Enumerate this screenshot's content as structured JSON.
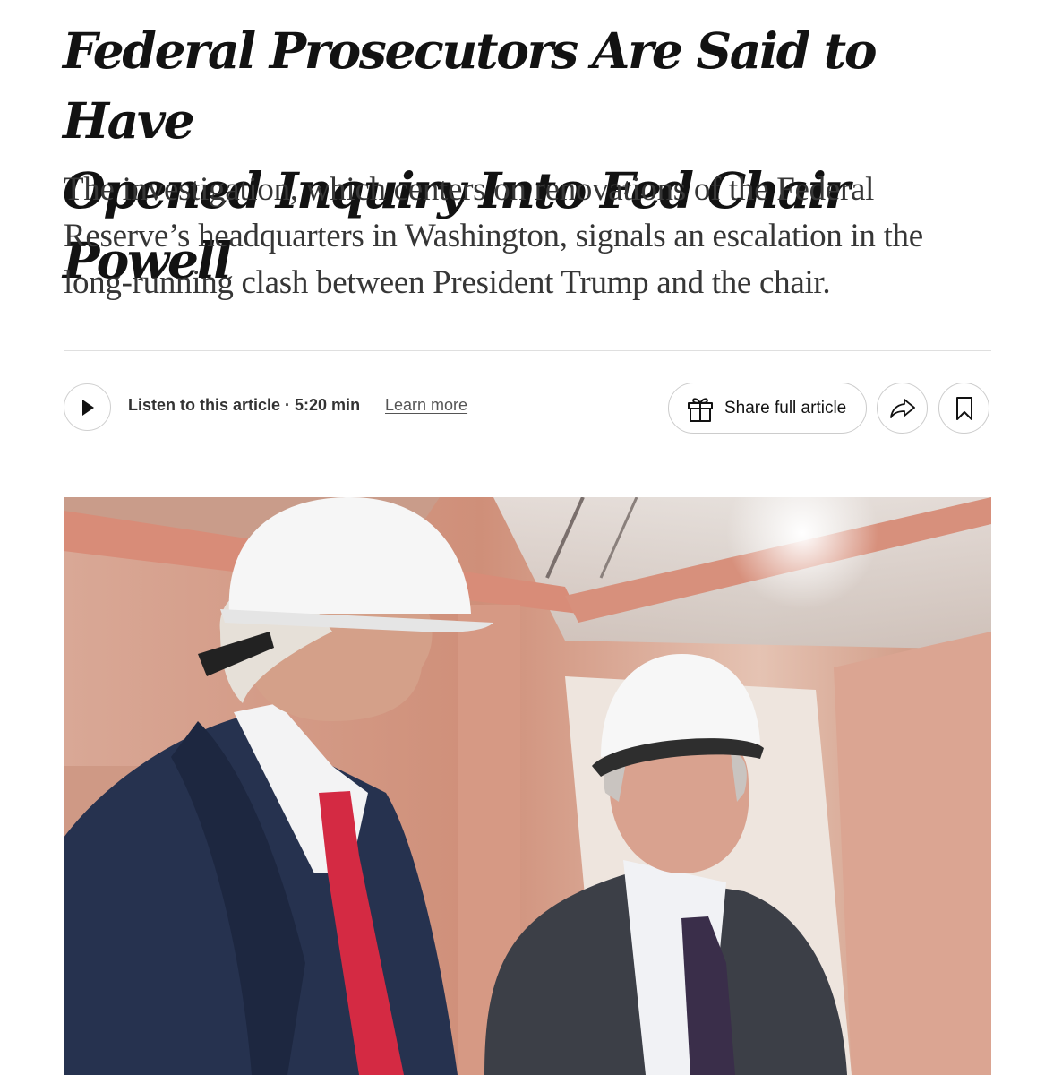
{
  "article": {
    "headline_line1": "Federal Prosecutors Are Said to Have",
    "headline_line2": "Opened Inquiry Into Fed Chair Powell",
    "dek": "The investigation, which centers on renovations of the Federal Reserve’s headquarters in Washington, signals an escalation in the long-running clash between President Trump and the chair."
  },
  "toolbar": {
    "play_icon": "play-icon",
    "listen_label": "Listen to this article · 5:20 min",
    "learn_more": "Learn more",
    "share_full_label": "Share full article",
    "share_full_icon": "gift-icon",
    "share_icon": "share-arrow-icon",
    "save_icon": "bookmark-icon"
  },
  "colors": {
    "text": "#121212",
    "dek": "#363636",
    "border": "#cccccc"
  }
}
